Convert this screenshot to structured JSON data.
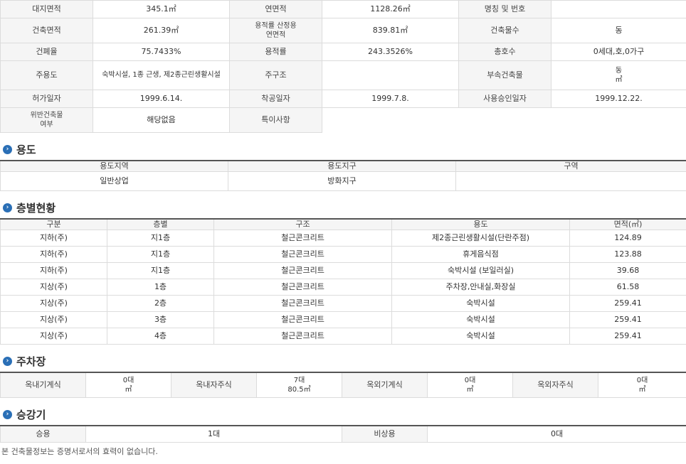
{
  "info": {
    "r1": [
      "대지면적",
      "345.1㎡",
      "연면적",
      "1128.26㎡",
      "명칭 및 번호",
      ""
    ],
    "r2": [
      "건축면적",
      "261.39㎡",
      "용적률 산정용\n연면적",
      "839.81㎡",
      "건축물수",
      "동"
    ],
    "r3": [
      "건폐율",
      "75.7433%",
      "용적률",
      "243.3526%",
      "총호수",
      "0세대,호,0가구"
    ],
    "r4": [
      "주용도",
      "숙박시설, 1종 근생, 제2종근린생활시설",
      "주구조",
      "",
      "부속건축물",
      "동\n㎡"
    ],
    "r5": [
      "허가일자",
      "1999.6.14.",
      "착공일자",
      "1999.7.8.",
      "사용승인일자",
      "1999.12.22."
    ],
    "r6": [
      "위반건축물\n여부",
      "해당없음",
      "특이사항",
      ""
    ]
  },
  "use": {
    "title": "용도",
    "headers": [
      "용도지역",
      "용도지구",
      "구역"
    ],
    "values": [
      "일반상업",
      "방화지구",
      ""
    ]
  },
  "floors": {
    "title": "층별현황",
    "headers": [
      "구분",
      "층별",
      "구조",
      "용도",
      "면적(㎡)"
    ],
    "rows": [
      [
        "지하(주)",
        "지1층",
        "철근콘크리트",
        "제2종근린생활시설(단란주점)",
        "124.89"
      ],
      [
        "지하(주)",
        "지1층",
        "철근콘크리트",
        "휴게음식점",
        "123.88"
      ],
      [
        "지하(주)",
        "지1층",
        "철근콘크리트",
        "숙박시설 (보일러실)",
        "39.68"
      ],
      [
        "지상(주)",
        "1층",
        "철근콘크리트",
        "주차장,안내실,화장실",
        "61.58"
      ],
      [
        "지상(주)",
        "2층",
        "철근콘크리트",
        "숙박시설",
        "259.41"
      ],
      [
        "지상(주)",
        "3층",
        "철근콘크리트",
        "숙박시설",
        "259.41"
      ],
      [
        "지상(주)",
        "4층",
        "철근콘크리트",
        "숙박시설",
        "259.41"
      ]
    ]
  },
  "parking": {
    "title": "주차장",
    "items": [
      {
        "label": "옥내기계식",
        "count": "0대",
        "area": "㎡"
      },
      {
        "label": "옥내자주식",
        "count": "7대",
        "area": "80.5㎡"
      },
      {
        "label": "옥외기계식",
        "count": "0대",
        "area": "㎡"
      },
      {
        "label": "옥외자주식",
        "count": "0대",
        "area": "㎡"
      }
    ]
  },
  "elevator": {
    "title": "승강기",
    "passenger_label": "승용",
    "passenger_value": "1대",
    "emergency_label": "비상용",
    "emergency_value": "0대"
  },
  "footer": "본 건축물정보는 증명서로서의 효력이 없습니다."
}
